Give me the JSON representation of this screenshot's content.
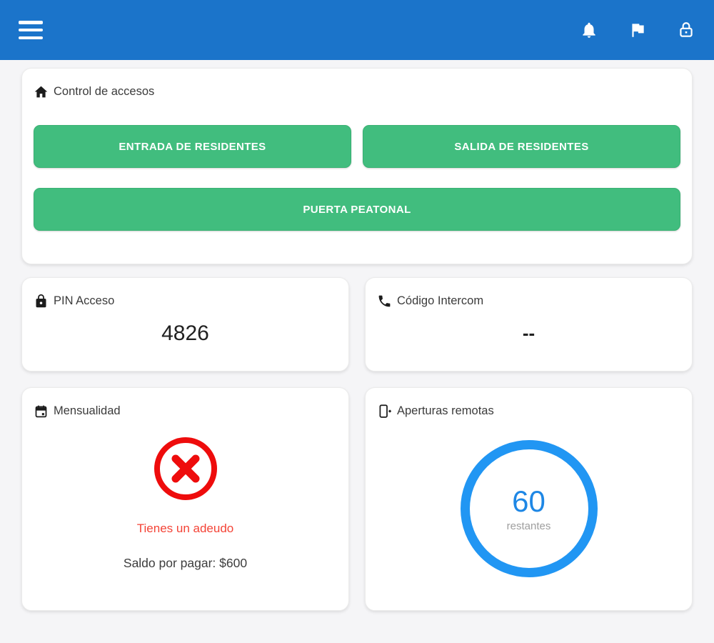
{
  "header": {
    "bg_color": "#1b74ca",
    "icons": [
      "menu",
      "bell",
      "flag",
      "lock"
    ]
  },
  "access_control": {
    "title": "Control de accesos",
    "button_color": "#41bd7e",
    "buttons": [
      {
        "label": "ENTRADA DE RESIDENTES"
      },
      {
        "label": "SALIDA DE RESIDENTES"
      },
      {
        "label": "PUERTA PEATONAL"
      }
    ]
  },
  "pin_card": {
    "title": "PIN Acceso",
    "value": "4826"
  },
  "intercom_card": {
    "title": "Código Intercom",
    "value": "--"
  },
  "monthly_card": {
    "title": "Mensualidad",
    "status_text": "Tienes un adeudo",
    "balance_text": "Saldo por pagar: $600",
    "status_color": "#f44336",
    "alert_icon_color": "#ee0c0c"
  },
  "remote_card": {
    "title": "Aperturas remotas",
    "count": "60",
    "count_label": "restantes",
    "ring_color": "#2196f3"
  }
}
